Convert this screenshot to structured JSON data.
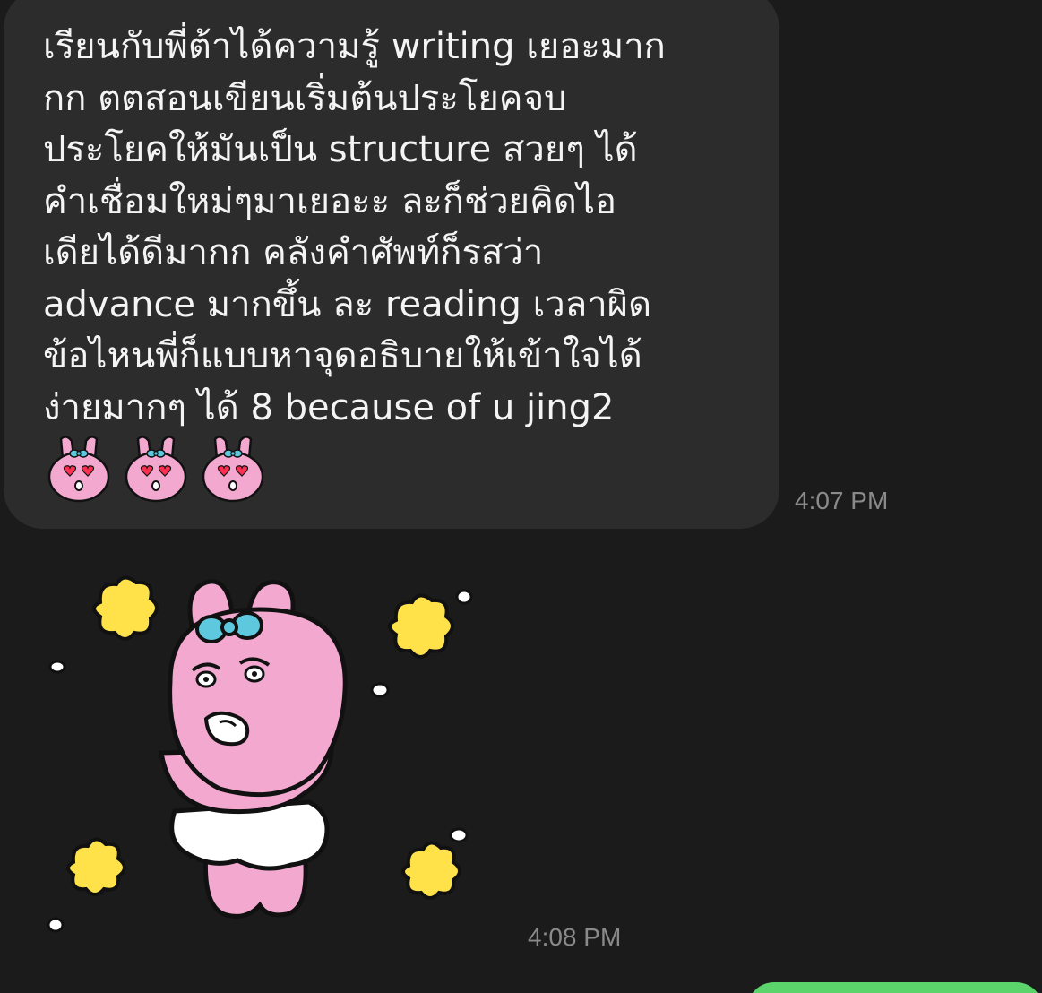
{
  "conversation": {
    "messages": [
      {
        "type": "text",
        "lines": [
          "เรียนกับพี่ต้าได้ความรู้ writing เยอะมาก",
          "กก ตตสอนเขียนเริ่มต้นประโยคจบ",
          "ประโยคให้มันเป็น structure สวยๆ ได้",
          "คำเชื่อมใหม่ๆมาเยอะะ ละก็ช่วยคิดไอ",
          "เดียได้ดีมากก คลังคำศัพท์ก็รสว่า",
          "advance มากขึ้น ละ reading เวลาผิด",
          "ข้อไหนพี่ก็แบบหาจุดอธิบายให้เข้าใจได้",
          "ง่ายมากๆ ได้ 8 because of u jing2"
        ],
        "emoji_count": 3,
        "emoji": "pink-bunny-heart-eyes-icon",
        "time": "4:07 PM"
      },
      {
        "type": "sticker",
        "sticker": "pink-bunny-sparkle-sticker",
        "time": "4:08 PM"
      }
    ]
  },
  "colors": {
    "background": "#1b1b1b",
    "bubble_received": "#2c2c2c",
    "bubble_sent": "#5bd46b",
    "bunny_pink": "#f2a8cf",
    "bow_blue": "#5ec8df",
    "sparkle_yellow": "#ffe24a"
  }
}
